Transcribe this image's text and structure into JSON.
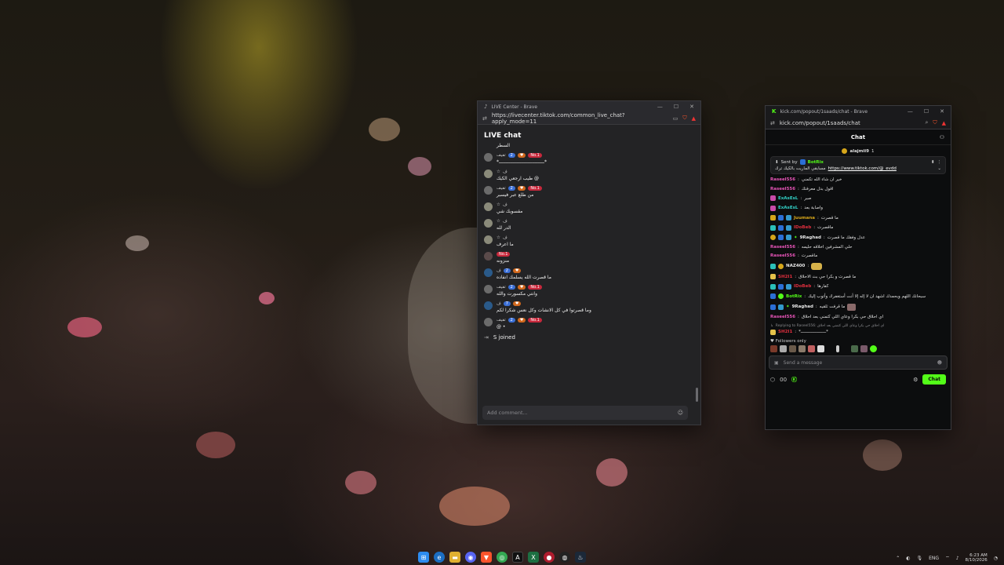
{
  "tiktok_window": {
    "title": "LIVE Center - Brave",
    "url": "https://livecenter.tiktok.com/common_live_chat?apply_mode=11",
    "heading": "LIVE chat",
    "top_text": "السطر",
    "messages": [
      {
        "name": "تفيف",
        "level": "2",
        "rank": "No.1",
        "text": "*ـــــــــــــــــــــــــــــــــ*"
      },
      {
        "name": "ف",
        "level": "",
        "rank": "",
        "text": "طيب ارجعي الكيك @"
      },
      {
        "name": "تفيف",
        "level": "2",
        "rank": "No.1",
        "text": "من طلع عبر فيسبر"
      },
      {
        "name": "ف",
        "level": "",
        "rank": "",
        "text": "مقسوبك شي"
      },
      {
        "name": "ف",
        "level": "",
        "rank": "",
        "text": "الدر لله"
      },
      {
        "name": "ف",
        "level": "",
        "rank": "",
        "text": "ما اعرف"
      },
      {
        "name": "",
        "level": "",
        "rank": "No.1",
        "text": "منزونه"
      },
      {
        "name": "ف",
        "level": "2",
        "rank": "",
        "text": "ما قصرت الله يسلمك انفاده"
      },
      {
        "name": "تفيف",
        "level": "2",
        "rank": "No.1",
        "text": "وانتي مكسورت والله"
      },
      {
        "name": "ف",
        "level": "7",
        "rank": "",
        "text": "وما قصرتوا في كل الانشات وكل نعس شكرا لكم"
      },
      {
        "name": "تفيف",
        "level": "2",
        "rank": "No.1",
        "text": "@ •"
      }
    ],
    "joined_text": "S joined",
    "comment_placeholder": "Add comment..."
  },
  "kick_window": {
    "title": "kick.com/popout/1saads/chat - Brave",
    "url": "kick.com/popout/1saads/chat",
    "chat_heading": "Chat",
    "top_user": "alajmii9",
    "top_user_count": "1",
    "pinned_sent_by": "Sent by",
    "pinned_bot": "BotRix",
    "pinned_text": "مسابقي الماريت بالكيك ترك",
    "pinned_link": "https://www.tiktok.com/@_evdd",
    "messages": [
      {
        "user": "Raseel556",
        "color": "#e754b8",
        "text": "خير ان شاء الله تكمني"
      },
      {
        "user": "Raseel556",
        "color": "#e754b8",
        "text": "اقول بدل معرفتك"
      },
      {
        "user": "ExAsEsL",
        "color": "#32d2c8",
        "text": "صبر"
      },
      {
        "user": "ExAsEsL",
        "color": "#32d2c8",
        "text": "واصابة بعد"
      },
      {
        "user": "Juumana",
        "color": "#d6a61a",
        "text": "ما قصرت"
      },
      {
        "user": "IDoBeb",
        "color": "#e02f3e",
        "text": "ماقصرت"
      },
      {
        "user": "9Raghad",
        "color": "#e6e6e6",
        "text": "عدل وفقك ما قصرت"
      },
      {
        "user": "Raseel556",
        "color": "#e754b8",
        "text": "حلي المشرفين اخلاقه حليمه"
      },
      {
        "user": "Raseel556",
        "color": "#e754b8",
        "text": "ماقصرت"
      },
      {
        "user": "NAZ400",
        "color": "#e6e6e6",
        "text": ""
      },
      {
        "user": "SH2I1",
        "color": "#e02f3e",
        "text": "ما قصرت و بكرا حي بث الاحلاق"
      },
      {
        "user": "IDoBeb",
        "color": "#e02f3e",
        "text": "كفارها"
      },
      {
        "user": "BotRix",
        "color": "#53fc18",
        "text": "سبحانك اللهم وبحمدك اشهد ان لا إله إلا أنت أستغفرك وأتوب إليك"
      },
      {
        "user": "9Raghad",
        "color": "#e6e6e6",
        "text": "ما قرفت ثلقيه"
      },
      {
        "user": "Raseel556",
        "color": "#e754b8",
        "text": "اي احلاق حي بكرا وعاي اللي كتمني بعد احلاق"
      }
    ],
    "reply_preview": "Replying to Raseel556: اي احلاق حي بكرا وعاي اللي كتمني بعد احلاق",
    "last_user": "SH2I1",
    "last_text": "*ــــــــــــــــــــ*",
    "followers_label": "Followers only",
    "input_placeholder": "Send a message",
    "footer_count": "00",
    "chat_button": "Chat"
  },
  "taskbar": {
    "lang": "ENG",
    "time": "6:23 AM",
    "date": "8/10/2026"
  }
}
